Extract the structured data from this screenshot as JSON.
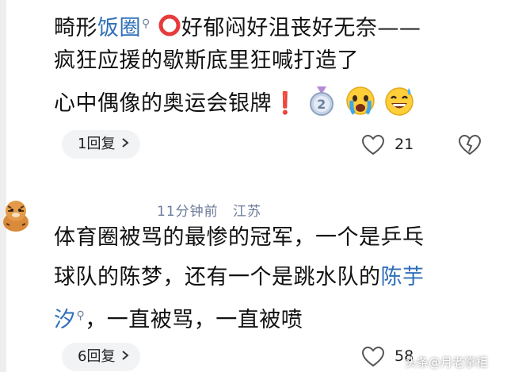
{
  "comment1": {
    "line1_prefix": "畸形",
    "line1_link": "饭圈",
    "line1_after": "好郁闷好沮丧好无奈——",
    "line2": "疯狂应援的歇斯底里狂喊打造了",
    "line3": "心中偶像的奥运会银牌",
    "line3_mark": "❗",
    "reply_label": "1回复",
    "like_count": "21"
  },
  "comment2": {
    "time": "11分钟前",
    "location": "江苏",
    "line1": "体育圈被骂的最惨的冠军，一个是乒乓",
    "line2_prefix": "球队的陈梦，还有一个是跳水队的",
    "line2_link": "陈芋",
    "line3_link": "汐",
    "line3_after": "，一直被骂，一直被喷",
    "reply_label": "6回复",
    "like_count": "58"
  },
  "watermark": "头条@月老掌柜",
  "colors": {
    "link": "#2f6fb8",
    "meta": "#6b7a99",
    "pill_bg": "#f2f3f5"
  }
}
